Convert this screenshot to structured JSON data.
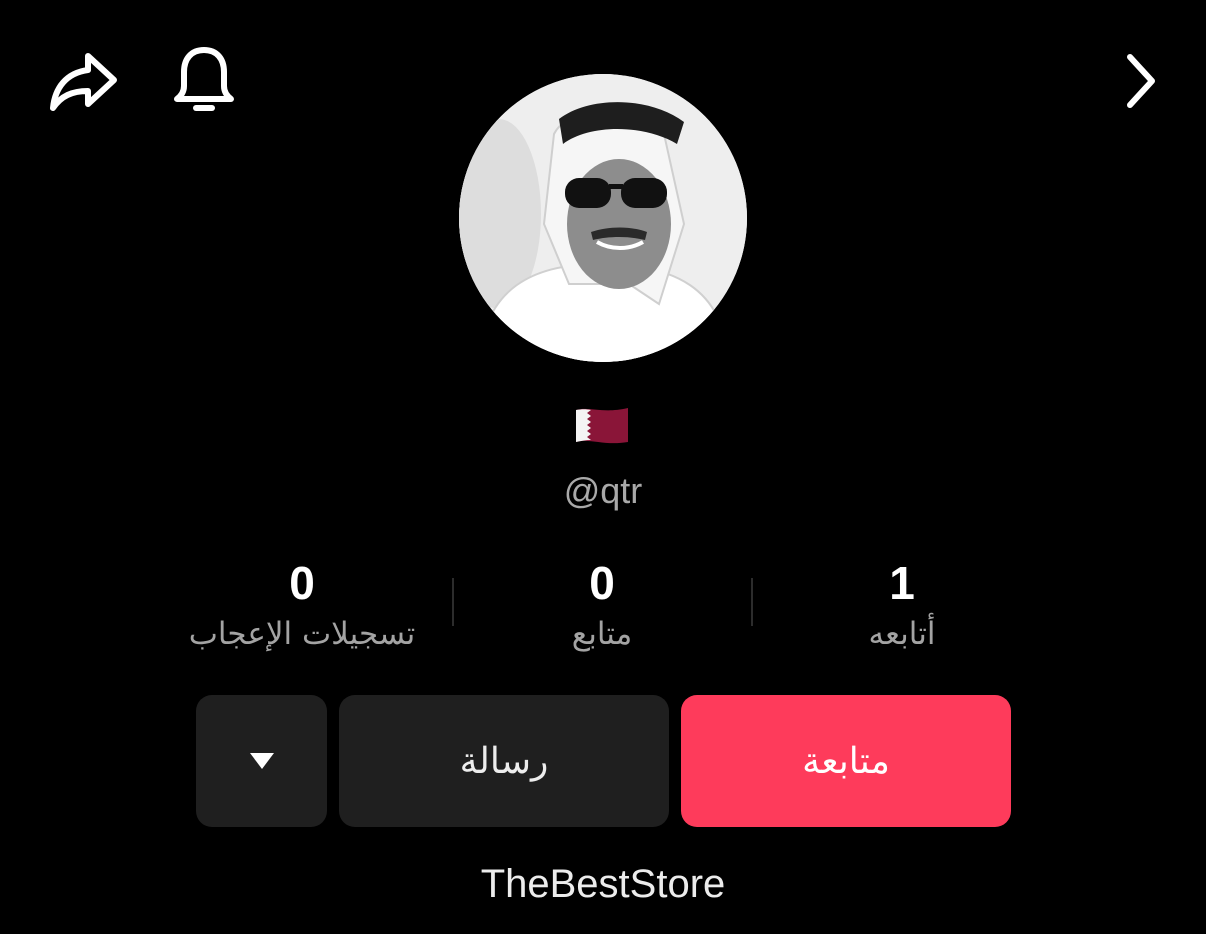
{
  "header": {
    "share_icon": "share-icon",
    "bell_icon": "bell-icon",
    "chevron_icon": "chevron-right-icon"
  },
  "profile": {
    "flag_icon": "qatar-flag-icon",
    "username": "@qtr"
  },
  "stats": {
    "likes": {
      "value": "0",
      "label": "تسجيلات الإعجاب"
    },
    "followers": {
      "value": "0",
      "label": "متابع"
    },
    "following": {
      "value": "1",
      "label": "أتابعه"
    }
  },
  "actions": {
    "follow_label": "متابعة",
    "message_label": "رسالة",
    "more_icon": "triangle-down-icon"
  },
  "bio": "TheBestStore",
  "colors": {
    "background": "#000000",
    "follow_button": "#fe3b5b",
    "secondary_button": "#1f1f1f",
    "muted_text": "#a3a3a3",
    "flag_maroon": "#8a1538"
  }
}
